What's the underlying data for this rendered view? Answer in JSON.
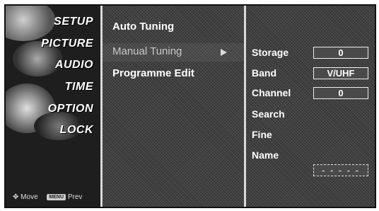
{
  "sidebar": {
    "items": [
      {
        "label": "SETUP"
      },
      {
        "label": "PICTURE"
      },
      {
        "label": "AUDIO"
      },
      {
        "label": "TIME"
      },
      {
        "label": "OPTION"
      },
      {
        "label": "LOCK"
      }
    ],
    "footer": {
      "move_label": "Move",
      "menu_key": "MENU",
      "prev_label": "Prev"
    }
  },
  "submenu": {
    "items": [
      {
        "label": "Auto Tuning"
      },
      {
        "label": "Manual Tuning"
      },
      {
        "label": "Programme Edit"
      }
    ]
  },
  "manual_tuning": {
    "storage_label": "Storage",
    "storage_value": "0",
    "band_label": "Band",
    "band_value": "V/UHF",
    "channel_label": "Channel",
    "channel_value": "0",
    "search_label": "Search",
    "fine_label": "Fine",
    "name_label": "Name",
    "name_value": "- - - - -"
  }
}
